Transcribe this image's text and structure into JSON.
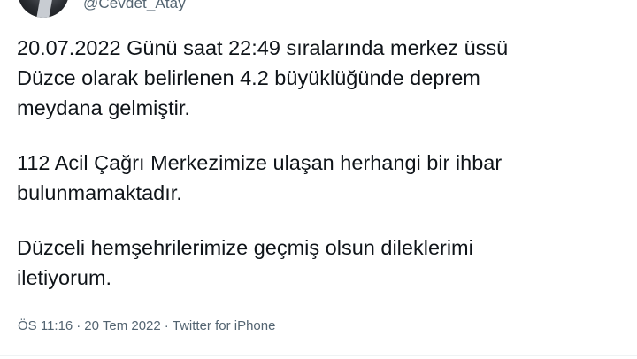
{
  "author": {
    "handle": "@Cevdet_Atay"
  },
  "tweet": {
    "paragraphs": [
      "20.07.2022 Günü saat 22:49 sıralarında merkez üssü\nDüzce olarak belirlenen 4.2 büyüklüğünde deprem\nmeydana gelmiştir.",
      "112 Acil Çağrı Merkezimize ulaşan herhangi bir ihbar\nbulunmamaktadır.",
      "Düzceli hemşehrilerimize geçmiş olsun dileklerimi\niletiyorum."
    ],
    "time": "ÖS 11:16",
    "date": "20 Tem 2022",
    "source": "Twitter for iPhone",
    "separator": "·"
  }
}
